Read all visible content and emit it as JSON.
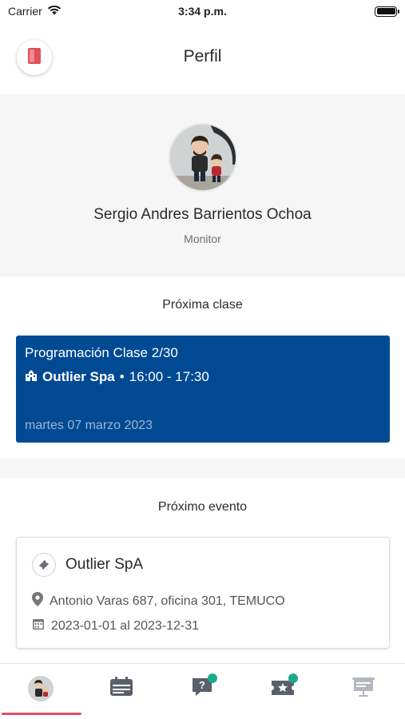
{
  "status_bar": {
    "carrier": "Carrier",
    "time": "3:34 p.m."
  },
  "header": {
    "title": "Perfil",
    "logout_icon": "logout-door-icon"
  },
  "profile": {
    "name": "Sergio Andres Barrientos Ochoa",
    "role": "Monitor"
  },
  "next_class": {
    "section_title": "Próxima clase",
    "title": "Programación Clase 2/30",
    "organization": "Outlier Spa",
    "separator": "•",
    "time_range": "16:00 - 17:30",
    "date": "martes 07 marzo 2023"
  },
  "next_event": {
    "section_title": "Próximo evento",
    "name": "Outlier SpA",
    "address": "Antonio Varas 687, oficina 301, TEMUCO",
    "date_range": "2023-01-01 al 2023-12-31"
  },
  "bottom_nav": {
    "items": [
      "profile",
      "schedule",
      "help",
      "tickets",
      "presentations"
    ],
    "active": "profile"
  },
  "colors": {
    "accent": "#e0506a",
    "class_card": "#004a94",
    "badge": "#1aab8e",
    "logout": "#e0505a"
  }
}
